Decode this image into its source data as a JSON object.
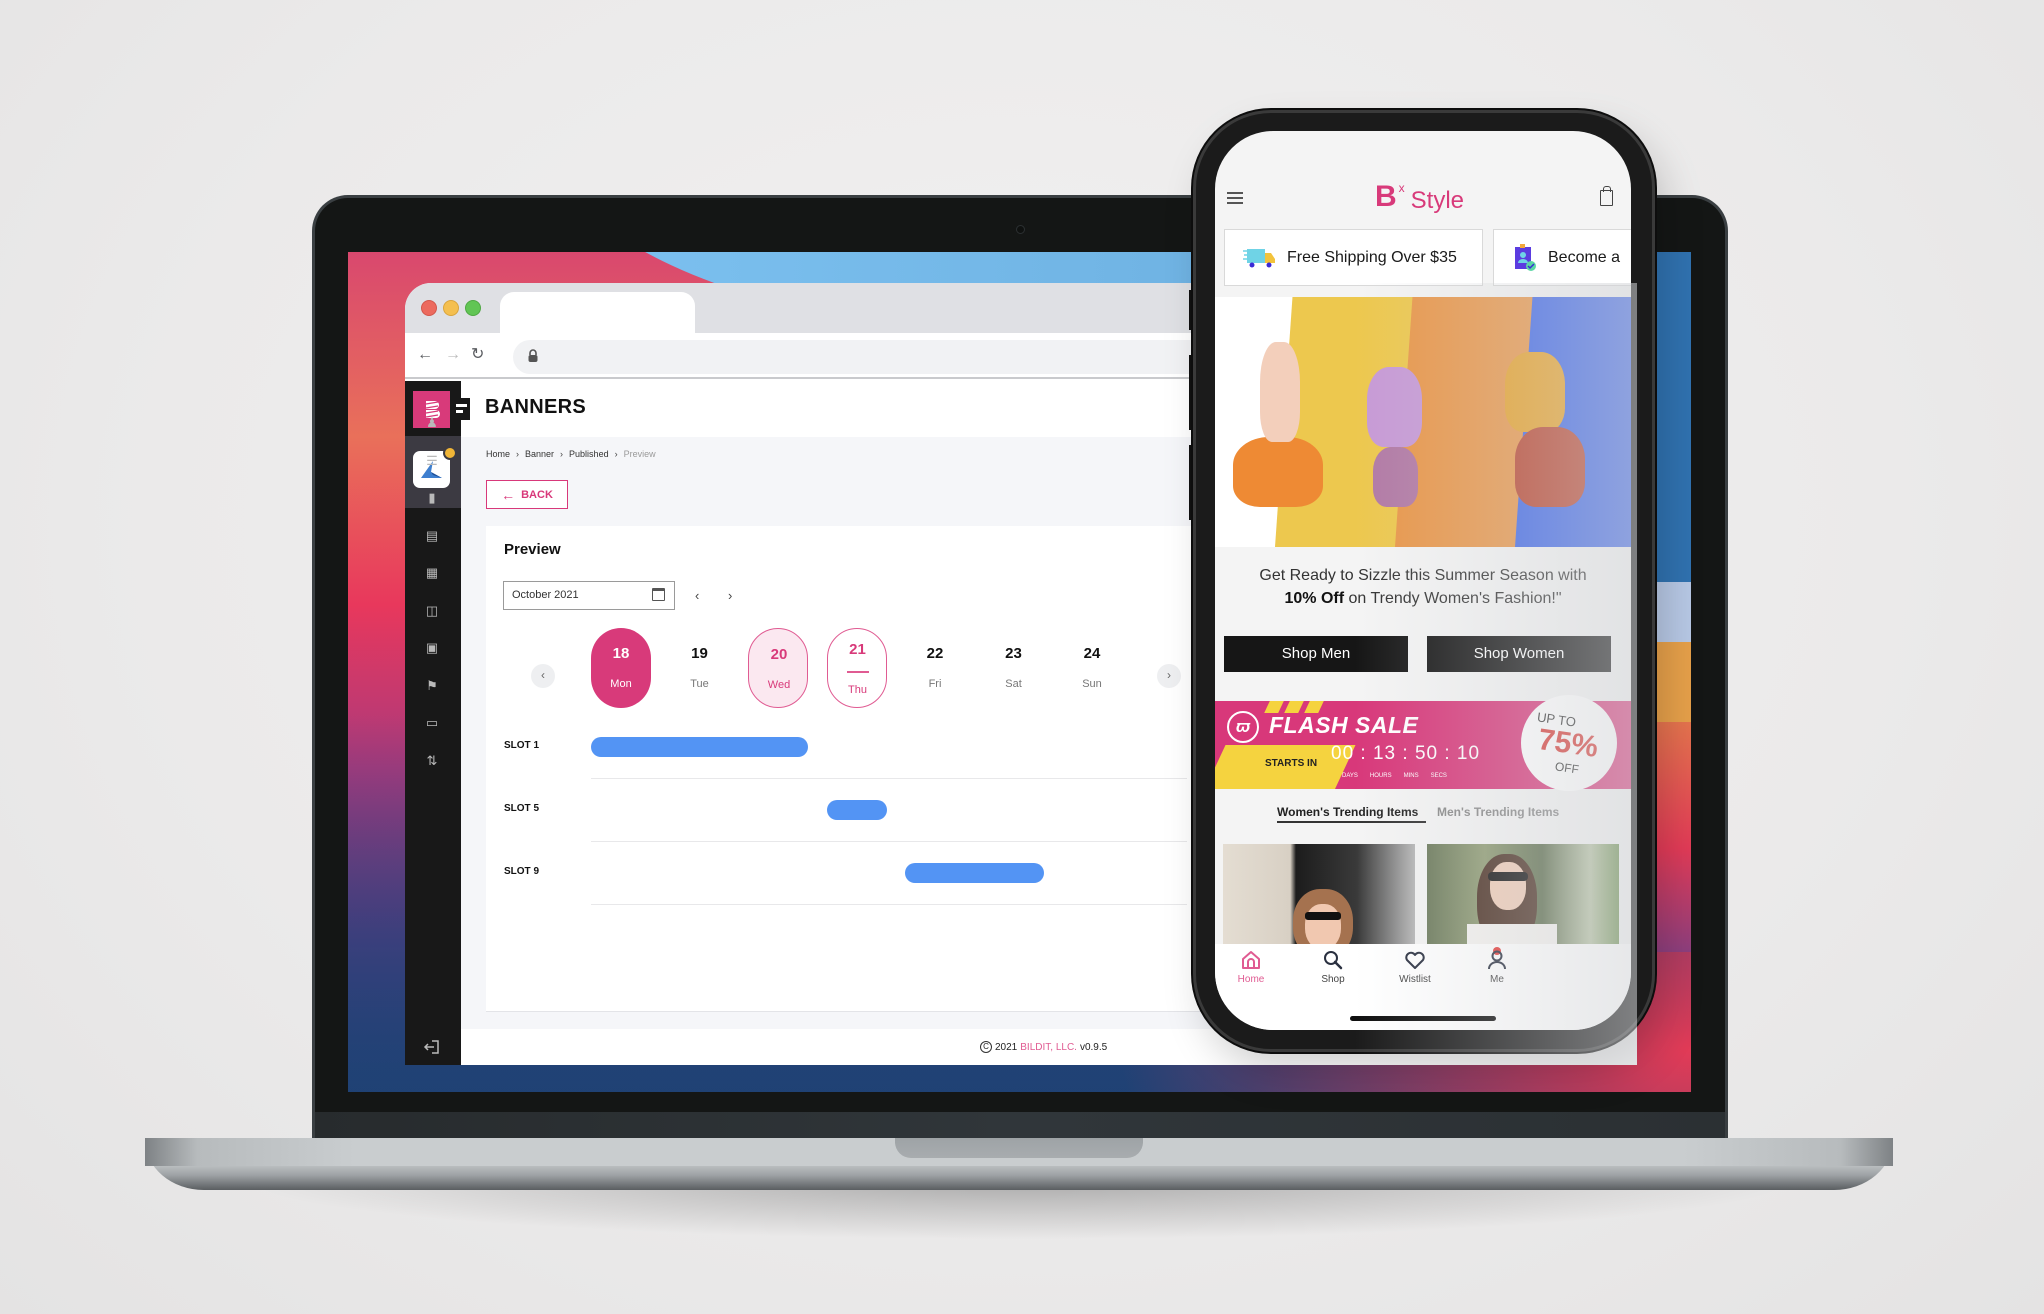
{
  "browser": {
    "url": ""
  },
  "admin_app": {
    "page_title": "BANNERS",
    "breadcrumb": [
      "Home",
      "Banner",
      "Published",
      "Preview"
    ],
    "back_label": "BACK",
    "card_title": "Preview",
    "month_value": "October 2021",
    "sidebar_icons": [
      "user-settings-icon",
      "list-layout-icon",
      "carousel-icon",
      "card-layout-icon",
      "image-icon",
      "page-layout-icon",
      "store-icon",
      "sign-icon",
      "code-folder-icon",
      "sliders-icon"
    ],
    "logout_icon": "logout-icon",
    "days": [
      {
        "num": "18",
        "dow": "Mon",
        "state": "selected"
      },
      {
        "num": "19",
        "dow": "Tue",
        "state": "normal"
      },
      {
        "num": "20",
        "dow": "Wed",
        "state": "range"
      },
      {
        "num": "21",
        "dow": "Thu",
        "state": "today"
      },
      {
        "num": "22",
        "dow": "Fri",
        "state": "normal"
      },
      {
        "num": "23",
        "dow": "Sat",
        "state": "normal"
      },
      {
        "num": "24",
        "dow": "Sun",
        "state": "normal"
      }
    ],
    "slots": [
      {
        "label": "SLOT 1",
        "start_day": "18",
        "end_day": "20"
      },
      {
        "label": "SLOT 5",
        "start_day": "21",
        "end_day": "21"
      },
      {
        "label": "SLOT 9",
        "start_day": "22",
        "end_day": "23"
      }
    ],
    "footer": {
      "copyright_symbol": "C",
      "year": "2021",
      "company": "BILDIT, LLC.",
      "version": "v0.9.5"
    }
  },
  "mobile_app": {
    "brand_letter": "B",
    "brand_superscript": "x",
    "brand_name": "Style",
    "promos": [
      {
        "icon": "truck-icon",
        "text": "Free Shipping Over $35"
      },
      {
        "icon": "member-badge-icon",
        "text": "Become a"
      }
    ],
    "hero_text_line1": "Get Ready to Sizzle this Summer Season with",
    "hero_text_bold": "10% Off",
    "hero_text_line2": " on Trendy Women's Fashion!\"",
    "shop_men": "Shop Men",
    "shop_women": "Shop Women",
    "flash_sale": {
      "title": "FLASH SALE",
      "starts_in": "STARTS IN",
      "countdown": "00 : 13 : 50 : 10",
      "labels": [
        "DAYS",
        "HOURS",
        "MINS",
        "SECS"
      ],
      "up_to": "UP TO",
      "percent": "75%",
      "off": "OFF"
    },
    "tabs": [
      "Women's Trending Items",
      "Men's Trending Items"
    ],
    "active_tab": 0,
    "bottom_nav": [
      {
        "label": "Home",
        "icon": "home-icon",
        "active": true
      },
      {
        "label": "Shop",
        "icon": "search-icon",
        "active": false
      },
      {
        "label": "Wistlist",
        "icon": "heart-icon",
        "active": false,
        "badge": true
      },
      {
        "label": "Me",
        "icon": "user-icon",
        "active": false
      }
    ]
  },
  "colors": {
    "brand_pink": "#d83a7a",
    "slot_bar_blue": "#5394f4",
    "flash_yellow": "#f5d33f",
    "discount_red": "#d93a35"
  }
}
